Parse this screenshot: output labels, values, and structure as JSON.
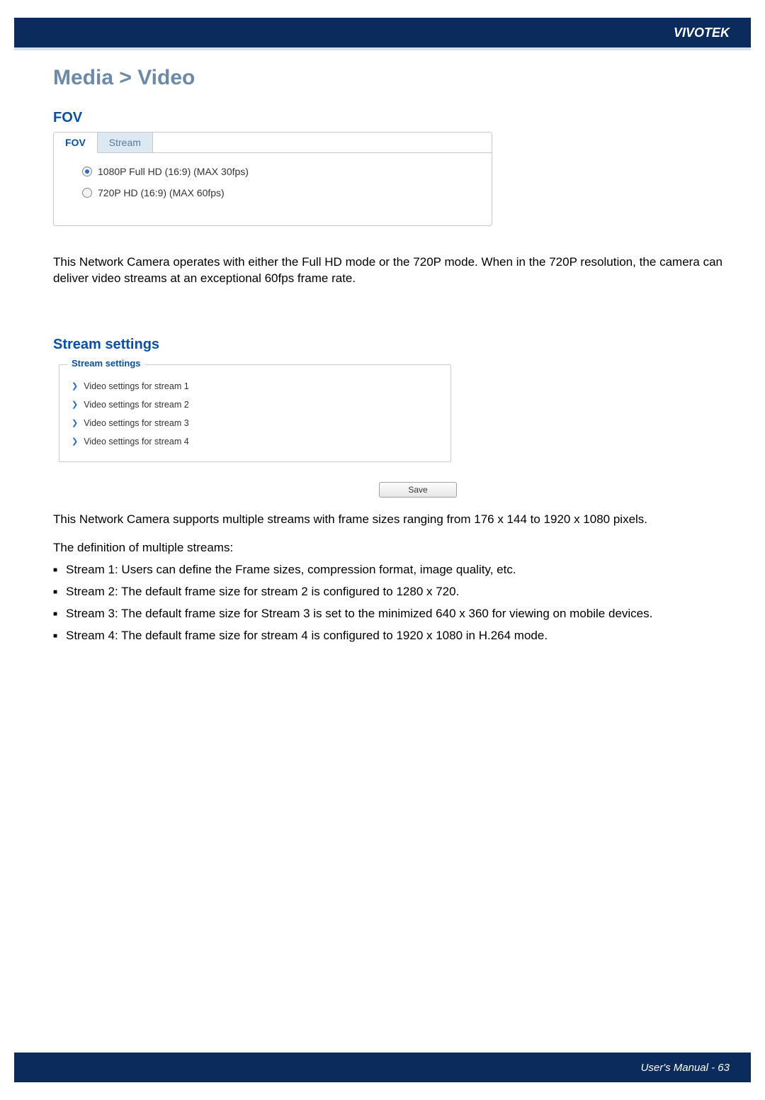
{
  "header": {
    "brand": "VIVOTEK"
  },
  "page": {
    "title": "Media > Video"
  },
  "fov": {
    "heading": "FOV",
    "tabs": {
      "fov": "FOV",
      "stream": "Stream"
    },
    "options": {
      "opt1": "1080P Full HD (16:9) (MAX 30fps)",
      "opt2": "720P HD (16:9) (MAX 60fps)"
    }
  },
  "para1": "This Network Camera operates with either the Full HD mode or the 720P mode. When in the 720P resolution, the camera can deliver video streams at an exceptional 60fps frame rate.",
  "stream": {
    "heading": "Stream settings",
    "legend": "Stream settings",
    "items": [
      "Video settings for stream 1",
      "Video settings for stream 2",
      "Video settings for stream 3",
      "Video settings for stream 4"
    ],
    "save": "Save"
  },
  "para2": "This Network Camera supports multiple streams with frame sizes ranging from 176 x 144 to 1920 x 1080 pixels.",
  "def_heading": "The definition of multiple streams:",
  "bullets": {
    "b1": "Stream 1: Users can define the Frame sizes, compression format, image quality, etc.",
    "b2": "Stream 2: The default frame size for stream 2 is configured to 1280 x 720.",
    "b3": "Stream 3: The default frame size for Stream 3 is set to the minimized 640 x 360 for viewing on mobile devices.",
    "b4": "Stream 4:  The default frame size for stream 4 is configured to 1920 x 1080 in H.264 mode."
  },
  "footer": {
    "text": "User's Manual - 63"
  }
}
